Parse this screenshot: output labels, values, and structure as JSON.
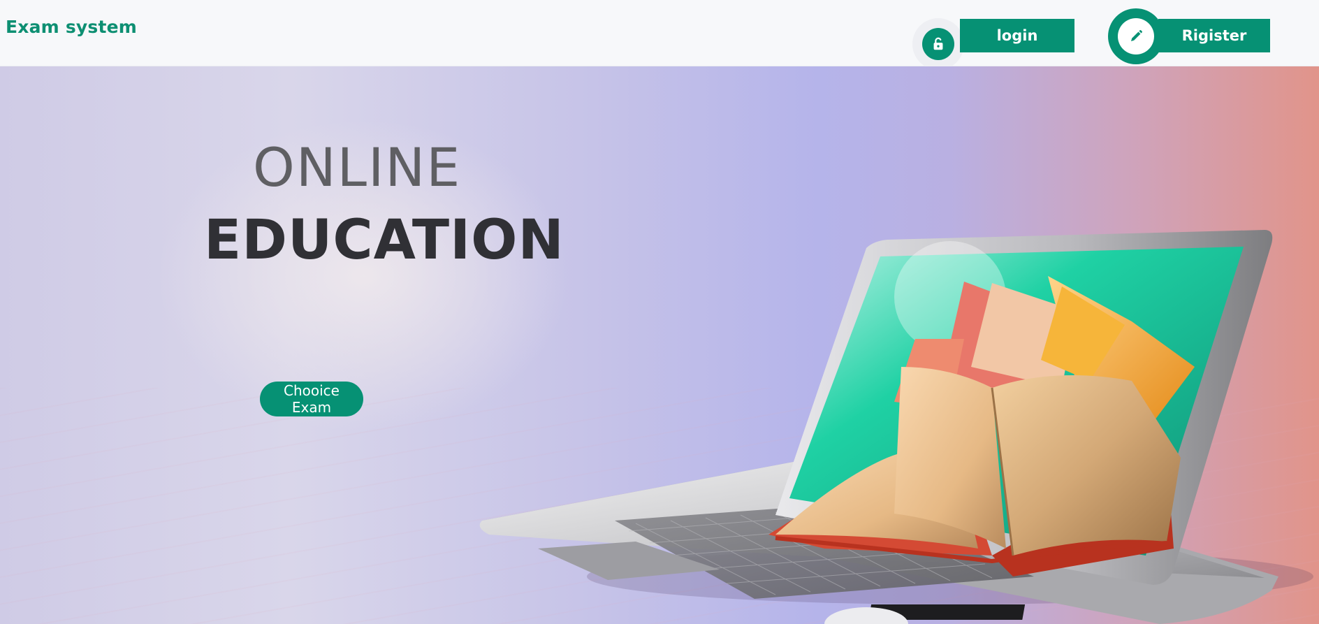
{
  "header": {
    "brand": "Exam system",
    "login_label": "login",
    "register_label": "Rigister",
    "icons": {
      "login": "unlock-icon",
      "register": "pencil-icon"
    }
  },
  "hero": {
    "title_line1": "ONLINE",
    "title_line2": "EDUCATION",
    "cta_label": "Chooice Exam",
    "illustration": "laptop-with-books"
  },
  "colors": {
    "accent": "#069174",
    "brand_text": "#0d8f72",
    "title_light": "#5f5f63",
    "title_dark": "#303035"
  }
}
